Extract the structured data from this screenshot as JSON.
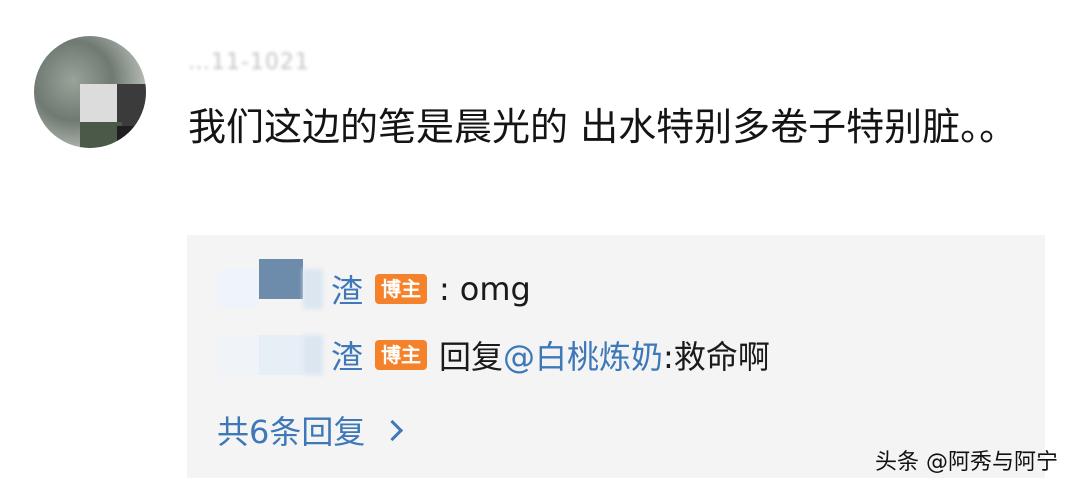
{
  "comment": {
    "meta_blurred": "…11-1021",
    "text": "我们这边的笔是晨光的 出水特别多卷子特别脏。。"
  },
  "replies": [
    {
      "name_visible": "渣",
      "badge": "博主",
      "separator": ":",
      "content": "omg"
    },
    {
      "name_visible": "渣",
      "badge": "博主",
      "verb": "回复",
      "mention": "@白桃炼奶",
      "content": ":救命啊"
    }
  ],
  "more_replies": "共6条回复",
  "watermark": "头条 @阿秀与阿宁",
  "colors": {
    "link": "#3e78b8",
    "badge": "#f5822a",
    "reply_bg": "#f4f4f4"
  }
}
